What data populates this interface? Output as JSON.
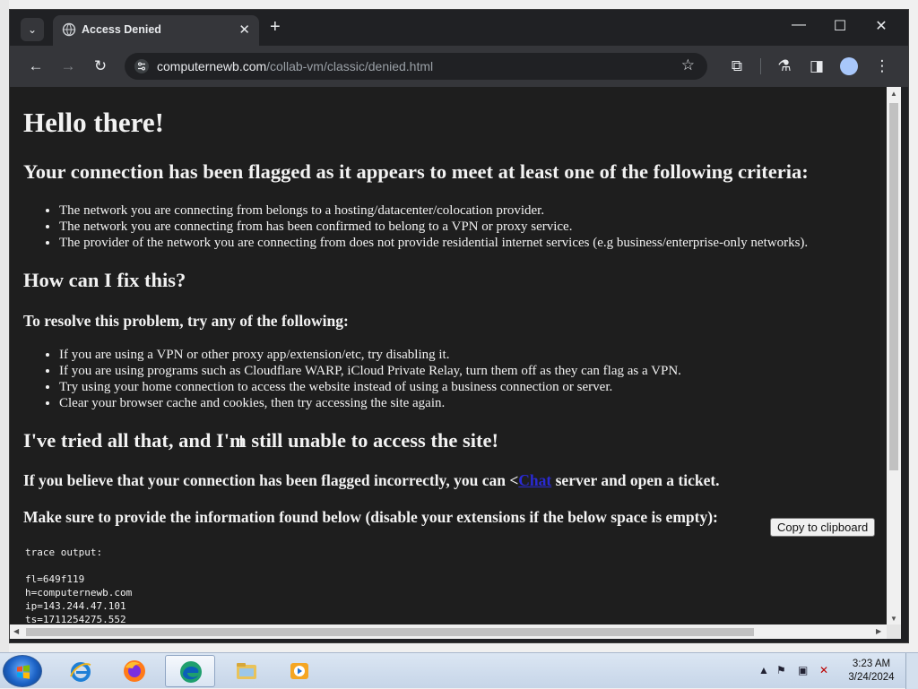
{
  "browser": {
    "tab_title": "Access Denied",
    "tab_close": "✕",
    "new_tab": "+",
    "url_host": "computernewb.com",
    "url_path": "/collab-vm/classic/denied.html"
  },
  "page": {
    "h1": "Hello there!",
    "h2_flagged": "Your connection has been flagged as it appears to meet at least one of the following criteria:",
    "criteria": [
      "The network you are connecting from belongs to a hosting/datacenter/colocation provider.",
      "The network you are connecting from has been confirmed to belong to a VPN or proxy service.",
      "The provider of the network you are connecting from does not provide residential internet services (e.g business/enterprise-only networks)."
    ],
    "h2_fix": "How can I fix this?",
    "h3_resolve": "To resolve this problem, try any of the following:",
    "fixes": [
      "If you are using a VPN or other proxy app/extension/etc, try disabling it.",
      "If you are using programs such as Cloudflare WARP, iCloud Private Relay, turn them off as they can flag as a VPN.",
      "Try using your home connection to access the website instead of using a business connection or server.",
      "Clear your browser cache and cookies, then try accessing the site again."
    ],
    "h2_tried": "I've tried all that, and I'm still unable to access the site!",
    "believe_before": "If you believe that your connection has been flagged incorrectly, you can <",
    "chat_link": "Chat",
    "believe_after": " server and open a ticket.",
    "provide_info": "Make sure to provide the information found below (disable your extensions if the below space is empty):",
    "copy_button": "Copy to clipboard",
    "trace": "trace output:\n\nfl=649f119\nh=computernewb.com\nip=143.244.47.101\nts=1711254275.552"
  },
  "taskbar": {
    "time": "3:23 AM",
    "date": "3/24/2024"
  },
  "colors": {
    "page_bg": "#1e1e1e",
    "chrome_dark": "#202124",
    "link": "#2a2ad4"
  },
  "icons": [
    "chevron-down-icon",
    "globe-tab-icon",
    "back-icon",
    "forward-icon",
    "reload-icon",
    "site-info-icon",
    "star-icon",
    "extensions-icon",
    "lab-icon",
    "side-panel-icon",
    "profile-icon",
    "menu-icon",
    "windows-start-icon",
    "ie-icon",
    "firefox-icon",
    "edge-icon",
    "explorer-icon",
    "media-player-icon"
  ]
}
